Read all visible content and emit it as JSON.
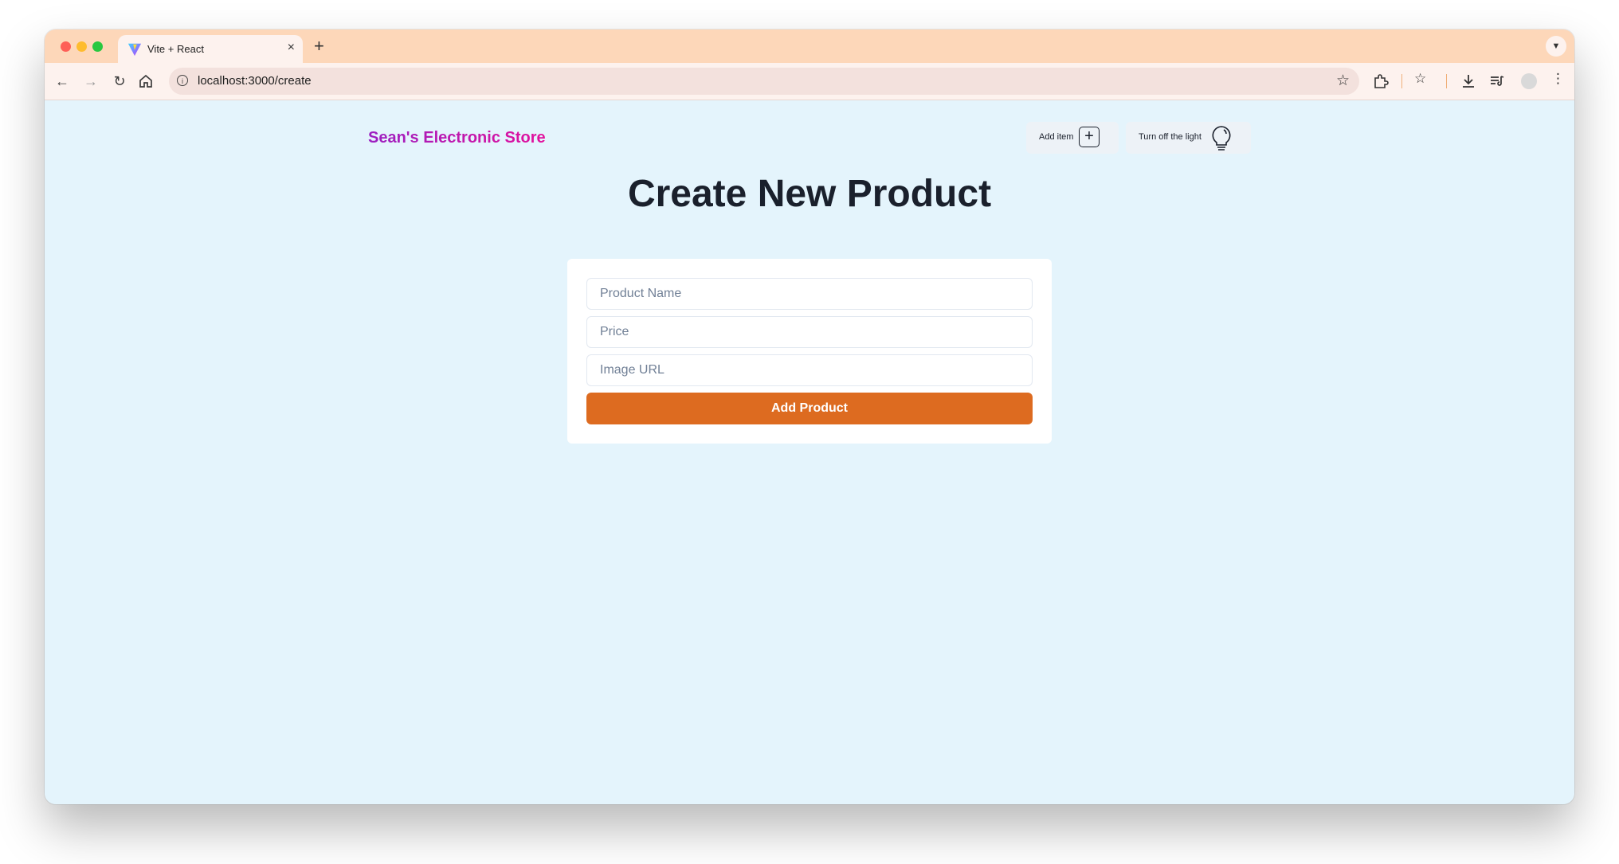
{
  "browser": {
    "tab_title": "Vite + React",
    "url": "localhost:3000/create",
    "accent_color": "#fdd7b9",
    "icons": [
      "back-icon",
      "forward-icon",
      "reload-icon",
      "home-icon",
      "site-info-icon",
      "bookmark-star-icon",
      "extensions-icon",
      "bookmarks-icon",
      "download-icon",
      "media-icon",
      "profile-icon",
      "menu-icon"
    ]
  },
  "header": {
    "brand": "Sean's Electronic Store",
    "add_item_label": "Add item",
    "toggle_light_label": "Turn off the light"
  },
  "page": {
    "title": "Create New Product"
  },
  "form": {
    "name_placeholder": "Product Name",
    "price_placeholder": "Price",
    "image_placeholder": "Image URL",
    "name_value": "",
    "price_value": "",
    "image_value": "",
    "submit_label": "Add Product",
    "submit_color": "#dd6b20"
  }
}
